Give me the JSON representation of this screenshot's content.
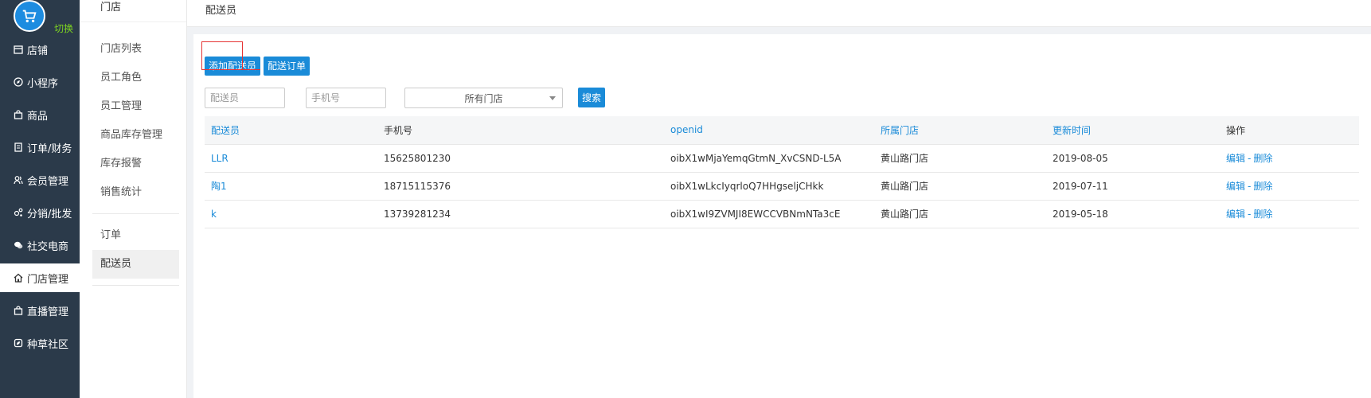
{
  "nav": {
    "switch_label": "切换",
    "items": [
      {
        "label": "店铺",
        "icon": "store-icon"
      },
      {
        "label": "小程序",
        "icon": "compass-icon"
      },
      {
        "label": "商品",
        "icon": "bag-icon"
      },
      {
        "label": "订单/财务",
        "icon": "receipt-icon"
      },
      {
        "label": "会员管理",
        "icon": "members-icon"
      },
      {
        "label": "分销/批发",
        "icon": "distribution-icon"
      },
      {
        "label": "社交电商",
        "icon": "chat-icon"
      },
      {
        "label": "门店管理",
        "icon": "home-icon"
      },
      {
        "label": "直播管理",
        "icon": "bag-icon"
      },
      {
        "label": "种草社区",
        "icon": "leaf-icon"
      }
    ]
  },
  "subnav": {
    "title": "门店",
    "items": [
      "门店列表",
      "员工角色",
      "员工管理",
      "商品库存管理",
      "库存报警",
      "销售统计"
    ],
    "items2": [
      "订单",
      "配送员"
    ]
  },
  "header": {
    "title": "配送员"
  },
  "toolbar": {
    "add_label": "添加配送员",
    "orders_label": "配送订单"
  },
  "filters": {
    "courier_placeholder": "配送员",
    "phone_placeholder": "手机号",
    "store_select": "所有门店",
    "search_label": "搜索"
  },
  "table": {
    "headers": [
      "配送员",
      "手机号",
      "openid",
      "所属门店",
      "更新时间",
      "操作"
    ],
    "rows": [
      {
        "name": "LLR",
        "phone": "15625801230",
        "openid": "oibX1wMjaYemqGtmN_XvCSND-L5A",
        "store": "黄山路门店",
        "updated": "2019-08-05"
      },
      {
        "name": "陶1",
        "phone": "18715115376",
        "openid": "oibX1wLkcIyqrloQ7HHgseljCHkk",
        "store": "黄山路门店",
        "updated": "2019-07-11"
      },
      {
        "name": "k",
        "phone": "13739281234",
        "openid": "oibX1wI9ZVMJI8EWCCVBNmNTa3cE",
        "store": "黄山路门店",
        "updated": "2019-05-18"
      }
    ],
    "edit_label": "编辑",
    "delete_label": "删除",
    "action_separator": "-"
  },
  "colors": {
    "nav_bg": "#2b3a4a",
    "accent": "#1a8bd8",
    "switch": "#7ed321",
    "highlight": "#e53333"
  }
}
